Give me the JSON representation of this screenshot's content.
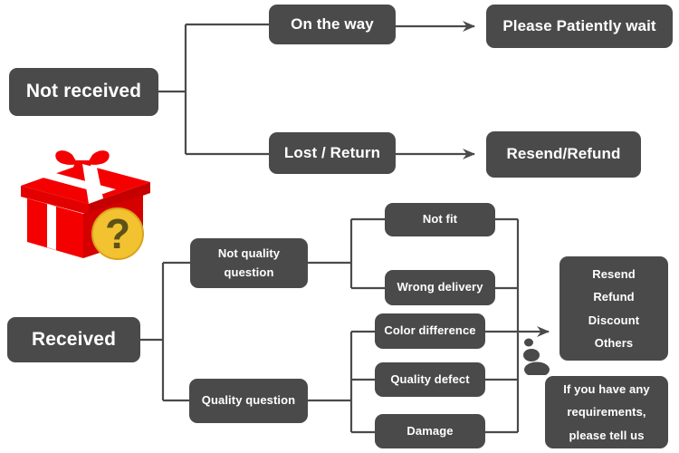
{
  "diagram": {
    "title": "Order issue resolution flowchart",
    "background_color": "#ffffff",
    "node_color": "#4a4a4a",
    "node_text_color": "#ffffff",
    "line_color": "#4a4a4a",
    "gift_color": "#f50000",
    "badge_color": "#f2c230"
  },
  "nodes": {
    "not_received": {
      "label": "Not received",
      "font_size": 21
    },
    "on_the_way": {
      "label": "On the way",
      "font_size": 17
    },
    "please_wait": {
      "label": "Please Patiently wait",
      "font_size": 17
    },
    "lost_return": {
      "label": "Lost / Return",
      "font_size": 17
    },
    "resend_refund": {
      "label": "Resend/Refund",
      "font_size": 17
    },
    "received": {
      "label": "Received",
      "font_size": 21
    },
    "not_quality_question": {
      "line1": "Not quality",
      "line2": "question",
      "font_size": 13
    },
    "quality_question": {
      "label": "Quality question",
      "font_size": 13
    },
    "not_fit": {
      "label": "Not fit",
      "font_size": 13
    },
    "wrong_delivery": {
      "label": "Wrong delivery",
      "font_size": 13
    },
    "color_difference": {
      "label": "Color difference",
      "font_size": 13
    },
    "quality_defect": {
      "label": "Quality defect",
      "font_size": 13
    },
    "damage": {
      "label": "Damage",
      "font_size": 13
    },
    "outcomes": {
      "line1": "Resend",
      "line2": "Refund",
      "line3": "Discount",
      "line4": "Others",
      "font_size": 13
    },
    "tell_us": {
      "line1": "If you have any",
      "line2": "requirements,",
      "line3": "please tell us",
      "font_size": 13
    }
  },
  "icons": {
    "gift_box": "gift-box-icon",
    "question_badge": "question-mark-badge-icon",
    "thought_dots": "thought-bubble-dots-icon"
  }
}
